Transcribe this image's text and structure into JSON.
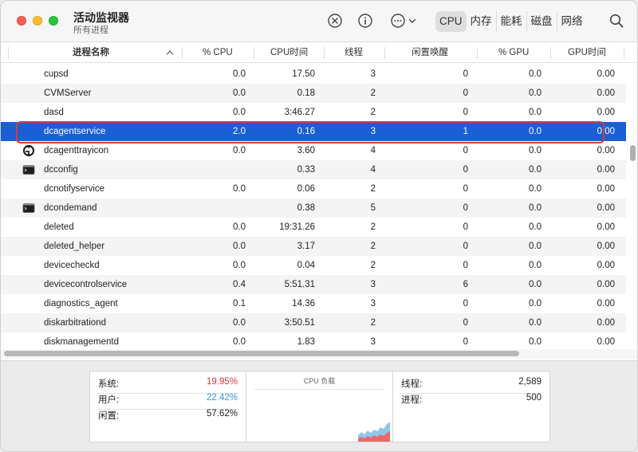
{
  "window": {
    "title": "活动监视器",
    "subtitle": "所有进程"
  },
  "toolbar": {
    "icons": [
      "close-circle-icon",
      "info-icon",
      "more-options-icon",
      "chevron-down-icon",
      "search-icon"
    ],
    "tabs": [
      {
        "label": "CPU",
        "active": true
      },
      {
        "label": "内存",
        "active": false
      },
      {
        "label": "能耗",
        "active": false
      },
      {
        "label": "磁盘",
        "active": false
      },
      {
        "label": "网络",
        "active": false
      }
    ]
  },
  "columns": [
    "进程名称",
    "% CPU",
    "CPU时间",
    "线程",
    "闲置唤醒",
    "% GPU",
    "GPU时间"
  ],
  "rows": [
    {
      "name": "cupsd",
      "cpu": "0.0",
      "cpu_time": "17.50",
      "threads": "3",
      "idle_wakeups": "0",
      "gpu": "0.0",
      "gpu_time": "0.00",
      "icon": ""
    },
    {
      "name": "CVMServer",
      "cpu": "0.0",
      "cpu_time": "0.18",
      "threads": "2",
      "idle_wakeups": "0",
      "gpu": "0.0",
      "gpu_time": "0.00",
      "icon": ""
    },
    {
      "name": "dasd",
      "cpu": "0.0",
      "cpu_time": "3:46.27",
      "threads": "2",
      "idle_wakeups": "0",
      "gpu": "0.0",
      "gpu_time": "0.00",
      "icon": ""
    },
    {
      "name": "dcagentservice",
      "cpu": "2.0",
      "cpu_time": "0.16",
      "threads": "3",
      "idle_wakeups": "1",
      "gpu": "0.0",
      "gpu_time": "0.00",
      "icon": "",
      "selected": true
    },
    {
      "name": "dcagenttrayicon",
      "cpu": "0.0",
      "cpu_time": "3.60",
      "threads": "4",
      "idle_wakeups": "0",
      "gpu": "0.0",
      "gpu_time": "0.00",
      "icon": "sync-agent-icon"
    },
    {
      "name": "dcconfig",
      "cpu": "",
      "cpu_time": "0.33",
      "threads": "4",
      "idle_wakeups": "0",
      "gpu": "0.0",
      "gpu_time": "0.00",
      "icon": "terminal-icon"
    },
    {
      "name": "dcnotifyservice",
      "cpu": "0.0",
      "cpu_time": "0.06",
      "threads": "2",
      "idle_wakeups": "0",
      "gpu": "0.0",
      "gpu_time": "0.00",
      "icon": ""
    },
    {
      "name": "dcondemand",
      "cpu": "",
      "cpu_time": "0.38",
      "threads": "5",
      "idle_wakeups": "0",
      "gpu": "0.0",
      "gpu_time": "0.00",
      "icon": "terminal-icon"
    },
    {
      "name": "deleted",
      "cpu": "0.0",
      "cpu_time": "19:31.26",
      "threads": "2",
      "idle_wakeups": "0",
      "gpu": "0.0",
      "gpu_time": "0.00",
      "icon": ""
    },
    {
      "name": "deleted_helper",
      "cpu": "0.0",
      "cpu_time": "3.17",
      "threads": "2",
      "idle_wakeups": "0",
      "gpu": "0.0",
      "gpu_time": "0.00",
      "icon": ""
    },
    {
      "name": "devicecheckd",
      "cpu": "0.0",
      "cpu_time": "0.04",
      "threads": "2",
      "idle_wakeups": "0",
      "gpu": "0.0",
      "gpu_time": "0.00",
      "icon": ""
    },
    {
      "name": "devicecontrolservice",
      "cpu": "0.4",
      "cpu_time": "5:51.31",
      "threads": "3",
      "idle_wakeups": "6",
      "gpu": "0.0",
      "gpu_time": "0.00",
      "icon": ""
    },
    {
      "name": "diagnostics_agent",
      "cpu": "0.1",
      "cpu_time": "14.36",
      "threads": "3",
      "idle_wakeups": "0",
      "gpu": "0.0",
      "gpu_time": "0.00",
      "icon": ""
    },
    {
      "name": "diskarbitrationd",
      "cpu": "0.0",
      "cpu_time": "3:50.51",
      "threads": "2",
      "idle_wakeups": "0",
      "gpu": "0.0",
      "gpu_time": "0.00",
      "icon": ""
    },
    {
      "name": "diskmanagementd",
      "cpu": "0.0",
      "cpu_time": "1.83",
      "threads": "3",
      "idle_wakeups": "0",
      "gpu": "0.0",
      "gpu_time": "0.00",
      "icon": ""
    }
  ],
  "bottom": {
    "system_label": "系统:",
    "system_value": "19.95%",
    "user_label": "用户:",
    "user_value": "22.42%",
    "idle_label": "闲置:",
    "idle_value": "57.62%",
    "graph_title": "CPU 负载",
    "threads_label": "线程:",
    "threads_value": "2,589",
    "processes_label": "进程:",
    "processes_value": "500"
  },
  "colors": {
    "selection": "#1a5fd6",
    "system": "#e0353a",
    "user": "#2d9bd6",
    "highlight_box": "#d93a3a"
  }
}
